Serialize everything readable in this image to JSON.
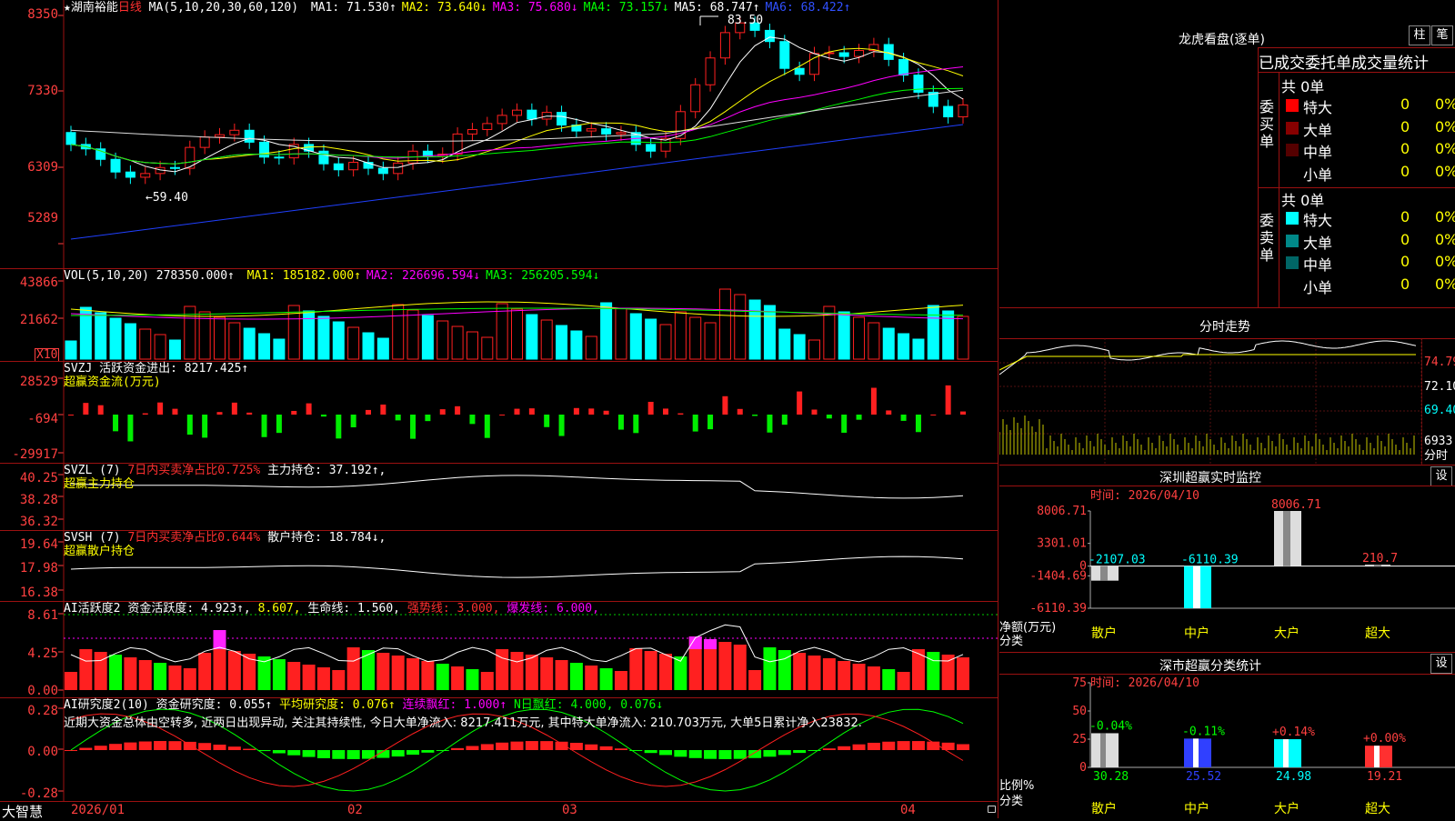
{
  "stock": {
    "name": "★湖南裕能",
    "period": "日线",
    "ma_params": "MA(5,10,20,30,60,120)"
  },
  "main": {
    "ma_values": [
      {
        "label": "MA1: 71.530↑",
        "color": "#ffffff"
      },
      {
        "label": "MA2: 73.640↓",
        "color": "#ffff00"
      },
      {
        "label": "MA3: 75.680↓",
        "color": "#ff00ff"
      },
      {
        "label": "MA4: 73.157↓",
        "color": "#00ff00"
      },
      {
        "label": "MA5: 68.747↑",
        "color": "#ffffff"
      },
      {
        "label": "MA6: 68.422↑",
        "color": "#3050ff"
      }
    ],
    "yticks": [
      "8350",
      "7330",
      "6309",
      "5289"
    ],
    "high_mark": "83.50",
    "low_mark": "←59.40"
  },
  "volume": {
    "title": "VOL(5,10,20)",
    "value": "278350.000↑",
    "ma": [
      {
        "label": "MA1: 185182.000↑",
        "color": "#ffff00"
      },
      {
        "label": "MA2: 226696.594↓",
        "color": "#ff00ff"
      },
      {
        "label": "MA3: 256205.594↓",
        "color": "#00ff00"
      }
    ],
    "yticks": [
      "43866",
      "21662"
    ],
    "unit": "X10"
  },
  "svzj": {
    "title": "SVZJ",
    "label": "活跃资金进出: 8217.425↑",
    "subtitle": "超赢资金流(万元)",
    "yticks": [
      "28529",
      "-694",
      "-29917"
    ]
  },
  "svzl": {
    "title": "SVZL (7)",
    "label1": "7日内买卖净占比0.725%",
    "label2": "主力持仓: 37.192↑,",
    "subtitle": "超赢主力持仓",
    "yticks": [
      "40.25",
      "38.28",
      "36.32"
    ]
  },
  "svsh": {
    "title": "SVSH (7)",
    "label1": "7日内买卖净占比0.644%",
    "label2": "散户持仓: 18.784↓,",
    "subtitle": "超赢散户持仓",
    "yticks": [
      "19.64",
      "17.98",
      "16.38"
    ]
  },
  "ai_active": {
    "title": "AI活跃度2",
    "label": "资金活跃度: 4.923↑,",
    "v2": "8.607,",
    "life": "生命线: 1.560,",
    "strong": "强势线: 3.000,",
    "burst": "爆发线: 6.000,",
    "yticks": [
      "8.61",
      "4.25",
      "0.00"
    ]
  },
  "ai_research": {
    "title": "AI研究度2(10)",
    "label": "资金研究度: 0.055↑",
    "avg": "平均研究度: 0.076↑",
    "cont": "连续飘红: 1.000↑",
    "nday": "N日飘红: 4.000, 0.076↓",
    "comment": "近期大资金总体由空转多, 近两日出现异动, 关注其持续性, 今日大单净流入: 8217.411万元, 其中特大单净流入: 210.703万元, 大单5日累计净入23832.",
    "yticks": [
      "0.28",
      "0.00",
      "-0.28"
    ]
  },
  "xaxis": [
    "2026/01",
    "02",
    "03",
    "04"
  ],
  "brand": "大智慧",
  "lhb": {
    "title": "龙虎看盘(逐单)",
    "btn1": "柱",
    "btn2": "笔",
    "header": "已成交委托单成交量统计",
    "buy_label": "委买单",
    "sell_label": "委卖单",
    "buy_total": "共 0单",
    "sell_total": "共 0单",
    "buy_rows": [
      {
        "name": "特大",
        "count": "0",
        "pct": "0%",
        "color": "#ff0000"
      },
      {
        "name": "大单",
        "count": "0",
        "pct": "0%",
        "color": "#880000"
      },
      {
        "name": "中单",
        "count": "0",
        "pct": "0%",
        "color": "#550000"
      },
      {
        "name": "小单",
        "count": "0",
        "pct": "0%",
        "color": ""
      }
    ],
    "sell_rows": [
      {
        "name": "特大",
        "count": "0",
        "pct": "0%",
        "color": "#00ffff"
      },
      {
        "name": "大单",
        "count": "0",
        "pct": "0%",
        "color": "#008888"
      },
      {
        "name": "中单",
        "count": "0",
        "pct": "0%",
        "color": "#006666"
      },
      {
        "name": "小单",
        "count": "0",
        "pct": "0%",
        "color": ""
      }
    ]
  },
  "intraday": {
    "title": "分时走势",
    "yticks": [
      "74.79",
      "72.10",
      "69.40",
      "6933"
    ],
    "unit": "分时"
  },
  "sz_monitor": {
    "title": "深圳超赢实时监控",
    "btn": "设",
    "time": "时间: 2026/04/10",
    "yticks": [
      "8006.71",
      "3301.01",
      "0",
      "-1404.69",
      "-6110.39"
    ],
    "ylabel": "净额(万元)",
    "xlabel": "分类",
    "cats": [
      "散户",
      "中户",
      "大户",
      "超大"
    ]
  },
  "sz_class": {
    "title": "深市超赢分类统计",
    "btn": "设",
    "time": "时间: 2026/04/10",
    "yticks": [
      "75",
      "50",
      "25",
      "0"
    ],
    "ylabel": "比例%",
    "xlabel": "分类",
    "cats": [
      "散户",
      "中户",
      "大户",
      "超大"
    ]
  },
  "chart_data": [
    {
      "type": "bar",
      "title": "深圳超赢实时监控",
      "categories": [
        "散户",
        "中户",
        "大户",
        "超大"
      ],
      "values": [
        -2107.03,
        -6110.39,
        8006.71,
        210.7
      ],
      "labels": [
        "-2107.03",
        "-6110.39",
        "8006.71",
        "210.7"
      ],
      "ylabel": "净额(万元)",
      "xlabel": "分类",
      "ylim": [
        -6110.39,
        8006.71
      ]
    },
    {
      "type": "bar",
      "title": "深市超赢分类统计",
      "categories": [
        "散户",
        "中户",
        "大户",
        "超大"
      ],
      "values": [
        30.28,
        25.52,
        24.98,
        19.21
      ],
      "labels": [
        "30.28",
        "25.52",
        "24.98",
        "19.21"
      ],
      "changes": [
        "-0.04%",
        "-0.11%",
        "+0.14%",
        "+0.00%"
      ],
      "ylabel": "比例%",
      "xlabel": "分类",
      "ylim": [
        0,
        75
      ]
    }
  ]
}
